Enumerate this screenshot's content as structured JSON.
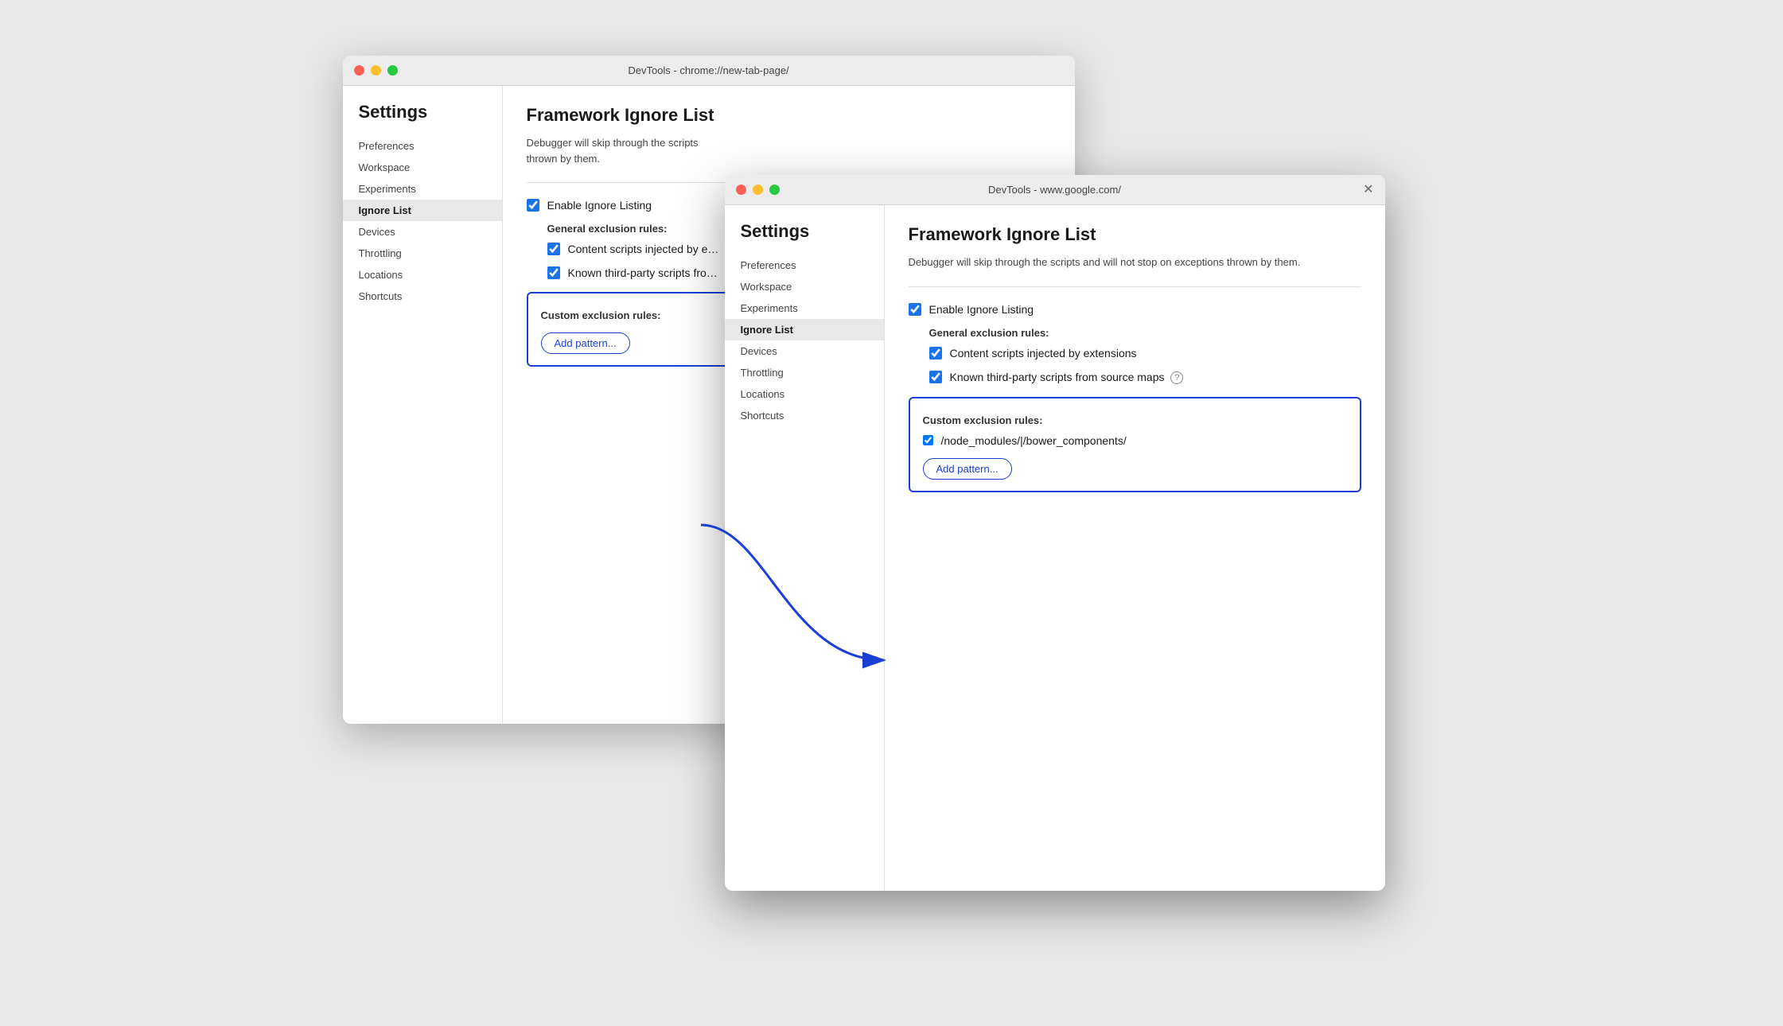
{
  "colors": {
    "accent_blue": "#1a3fd4",
    "checkbox_blue": "#1a73e8",
    "text_dark": "#1a1a1a",
    "text_medium": "#444",
    "sidebar_active_bg": "#e8e8e8",
    "border": "#e0e0e0"
  },
  "window_back": {
    "title": "DevTools - chrome://new-tab-page/",
    "settings_heading": "Settings",
    "sidebar": {
      "items": [
        {
          "label": "Preferences",
          "active": false
        },
        {
          "label": "Workspace",
          "active": false
        },
        {
          "label": "Experiments",
          "active": false
        },
        {
          "label": "Ignore List",
          "active": true
        },
        {
          "label": "Devices",
          "active": false
        },
        {
          "label": "Throttling",
          "active": false
        },
        {
          "label": "Locations",
          "active": false
        },
        {
          "label": "Shortcuts",
          "active": false
        }
      ]
    },
    "main": {
      "title": "Framework Ignore List",
      "description": "Debugger will skip through the scripts\nthrown by them.",
      "enable_ignore_listing_label": "Enable Ignore Listing",
      "general_exclusion_label": "General exclusion rules:",
      "rule1_label": "Content scripts injected by e…",
      "rule2_label": "Known third-party scripts fro…",
      "custom_exclusion_label": "Custom exclusion rules:",
      "add_pattern_label": "Add pattern..."
    }
  },
  "window_front": {
    "title": "DevTools - www.google.com/",
    "settings_heading": "Settings",
    "sidebar": {
      "items": [
        {
          "label": "Preferences",
          "active": false
        },
        {
          "label": "Workspace",
          "active": false
        },
        {
          "label": "Experiments",
          "active": false
        },
        {
          "label": "Ignore List",
          "active": true
        },
        {
          "label": "Devices",
          "active": false
        },
        {
          "label": "Throttling",
          "active": false
        },
        {
          "label": "Locations",
          "active": false
        },
        {
          "label": "Shortcuts",
          "active": false
        }
      ]
    },
    "main": {
      "title": "Framework Ignore List",
      "description": "Debugger will skip through the scripts and will not stop on exceptions thrown by them.",
      "enable_ignore_listing_label": "Enable Ignore Listing",
      "general_exclusion_label": "General exclusion rules:",
      "rule1_label": "Content scripts injected by extensions",
      "rule2_label": "Known third-party scripts from source maps",
      "custom_exclusion_label": "Custom exclusion rules:",
      "custom_rule_value": "/node_modules/|/bower_components/",
      "add_pattern_label": "Add pattern..."
    }
  }
}
